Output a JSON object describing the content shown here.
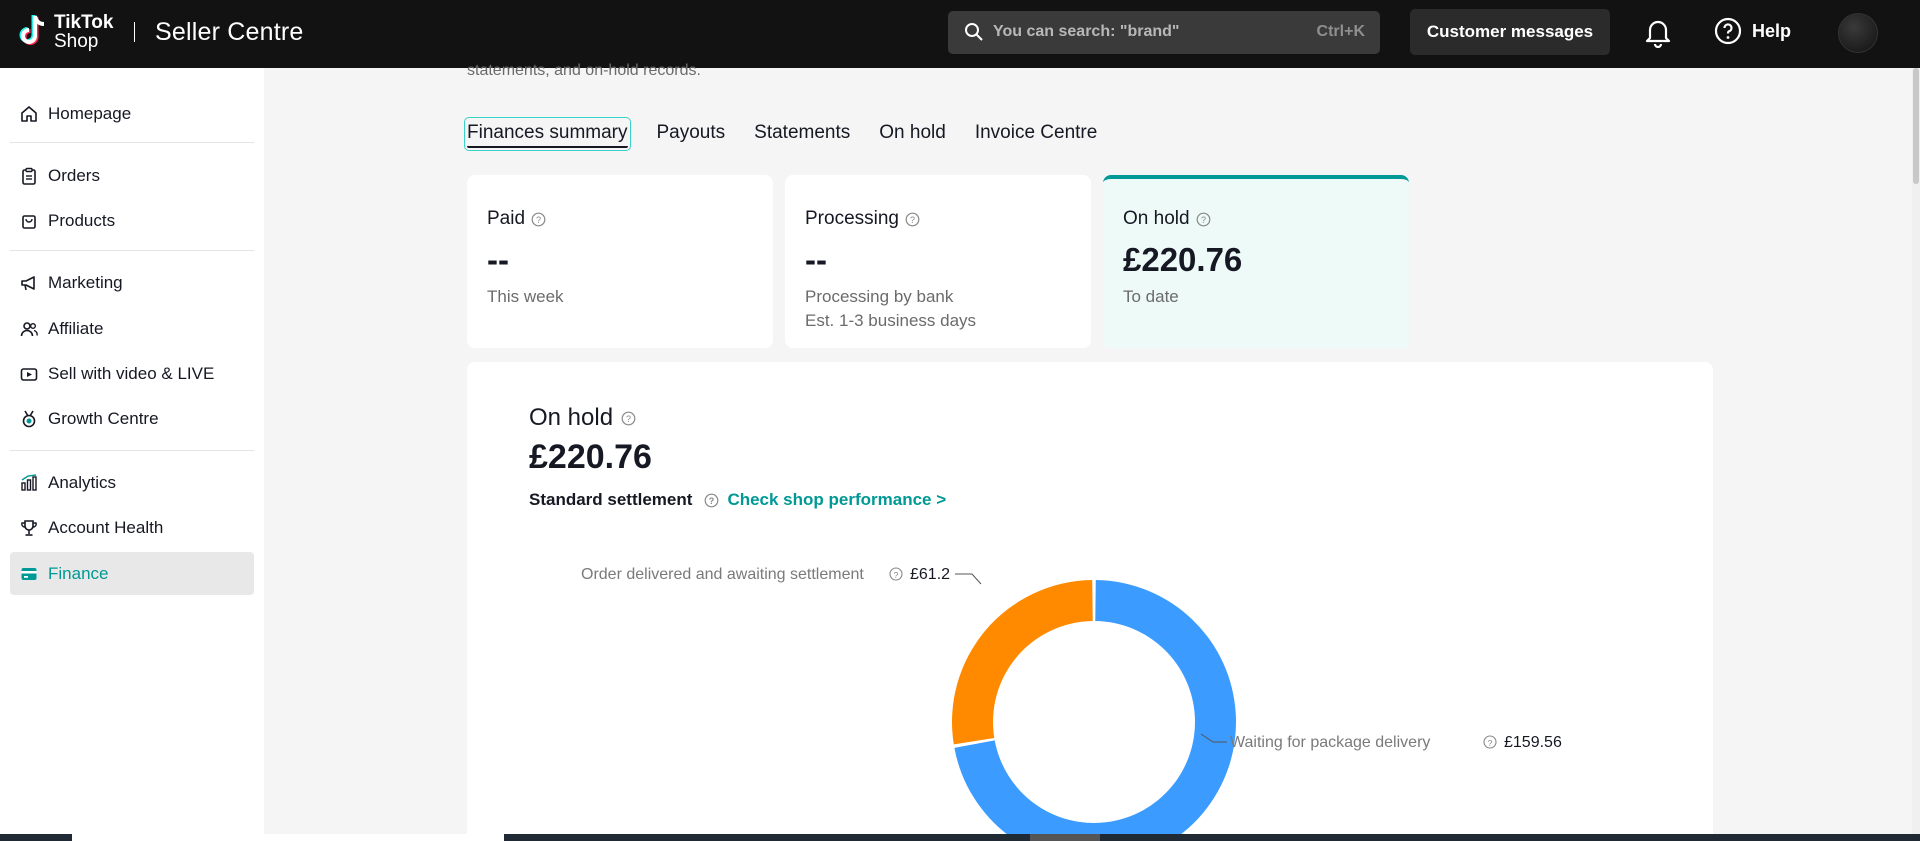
{
  "header": {
    "logo_line1": "TikTok",
    "logo_line2": "Shop",
    "title": "Seller Centre",
    "search_placeholder": "You can search: \"brand\"",
    "search_shortcut": "Ctrl+K",
    "customer_messages": "Customer messages",
    "help": "Help"
  },
  "sidebar": {
    "items": [
      {
        "label": "Homepage",
        "icon": "home-icon"
      },
      {
        "label": "Orders",
        "icon": "clipboard-icon"
      },
      {
        "label": "Products",
        "icon": "bag-icon"
      },
      {
        "label": "Marketing",
        "icon": "megaphone-icon"
      },
      {
        "label": "Affiliate",
        "icon": "people-icon"
      },
      {
        "label": "Sell with video & LIVE",
        "icon": "video-icon"
      },
      {
        "label": "Growth Centre",
        "icon": "medal-icon"
      },
      {
        "label": "Analytics",
        "icon": "bar-chart-icon"
      },
      {
        "label": "Account Health",
        "icon": "trophy-icon"
      },
      {
        "label": "Finance",
        "icon": "wallet-icon",
        "active": true
      }
    ]
  },
  "main": {
    "subtext": "statements, and on-hold records.",
    "tabs": [
      {
        "label": "Finances summary",
        "active": true
      },
      {
        "label": "Payouts"
      },
      {
        "label": "Statements"
      },
      {
        "label": "On hold"
      },
      {
        "label": "Invoice Centre"
      }
    ],
    "cards": [
      {
        "title": "Paid",
        "value": "--",
        "sub1": "This week",
        "sub2": ""
      },
      {
        "title": "Processing",
        "value": "--",
        "sub1": "Processing by bank",
        "sub2": "Est. 1-3 business days"
      },
      {
        "title": "On hold",
        "value": "£220.76",
        "sub1": "To date",
        "sub2": "",
        "selected": true
      }
    ],
    "panel": {
      "title": "On hold",
      "value": "£220.76",
      "settlement_label": "Standard settlement",
      "link": "Check shop performance >"
    }
  },
  "colors": {
    "accent": "#009995",
    "orange": "#FF8A00",
    "blue": "#3B9BFF"
  },
  "chart_data": {
    "type": "pie",
    "donut": true,
    "categories": [
      "Order delivered and awaiting settlement",
      "Waiting for package delivery"
    ],
    "values": [
      61.2,
      159.56
    ],
    "value_labels": [
      "£61.2",
      "£159.56"
    ],
    "colors": [
      "#FF8A00",
      "#3B9BFF"
    ]
  }
}
